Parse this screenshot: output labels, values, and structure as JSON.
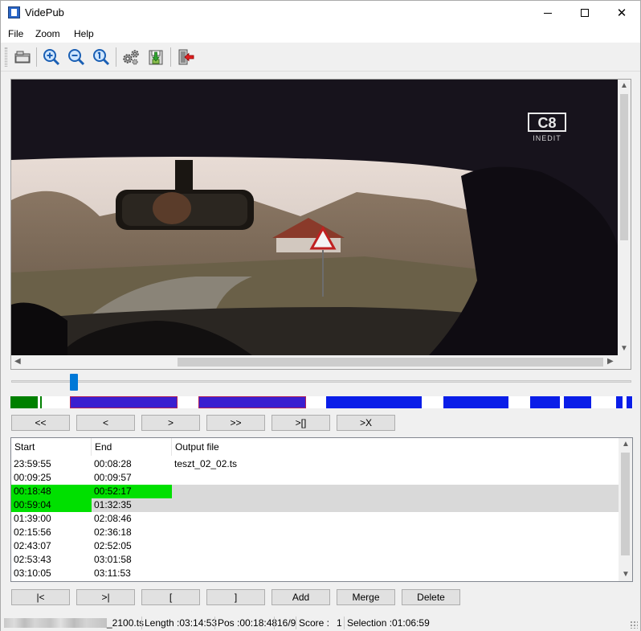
{
  "window": {
    "title": "VidePub"
  },
  "menu": {
    "items": [
      "File",
      "Zoom",
      "Help"
    ]
  },
  "toolbar": {
    "buttons": [
      "open-icon",
      "zoom-in-icon",
      "zoom-out-icon",
      "zoom-reset-icon",
      "settings-icon",
      "save-icon",
      "exit-icon"
    ]
  },
  "video": {
    "channel_logo": "C8",
    "channel_tag": "INEDIT"
  },
  "nav": {
    "buttons": [
      "<<",
      "<",
      ">",
      ">>",
      ">[]",
      ">X"
    ]
  },
  "segments": {
    "colors": {
      "dark_green": "#008000",
      "purple": "#3a1fd0",
      "blue": "#0a1ee8",
      "purple_border": "#b0205a"
    }
  },
  "list": {
    "columns": [
      "Start",
      "End",
      "Output file"
    ],
    "rows": [
      {
        "start": "23:59:55",
        "end": "00:08:28",
        "output": "teszt_02_02.ts",
        "selected": false,
        "green": "none"
      },
      {
        "start": "00:09:25",
        "end": "00:09:57",
        "output": "",
        "selected": false,
        "green": "none"
      },
      {
        "start": "00:18:48",
        "end": "00:52:17",
        "output": "",
        "selected": true,
        "green": "both"
      },
      {
        "start": "00:59:04",
        "end": "01:32:35",
        "output": "",
        "selected": true,
        "green": "start"
      },
      {
        "start": "01:39:00",
        "end": "02:08:46",
        "output": "",
        "selected": false,
        "green": "none"
      },
      {
        "start": "02:15:56",
        "end": "02:36:18",
        "output": "",
        "selected": false,
        "green": "none"
      },
      {
        "start": "02:43:07",
        "end": "02:52:05",
        "output": "",
        "selected": false,
        "green": "none"
      },
      {
        "start": "02:53:43",
        "end": "03:01:58",
        "output": "",
        "selected": false,
        "green": "none"
      },
      {
        "start": "03:10:05",
        "end": "03:11:53",
        "output": "",
        "selected": false,
        "green": "none"
      }
    ]
  },
  "actions": {
    "buttons": [
      "|<",
      ">|",
      "[",
      "]",
      "Add",
      "Merge",
      "Delete"
    ]
  },
  "status": {
    "filename_suffix": "_2100.ts",
    "length": "Length :03:14:53",
    "pos": "Pos :00:18:48",
    "count": "16/9",
    "score_label": "Score :",
    "score_value": "1",
    "selection": "Selection :01:06:59"
  }
}
